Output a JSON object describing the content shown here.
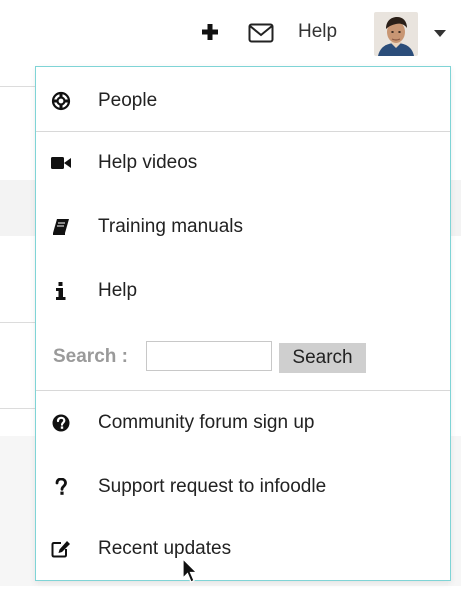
{
  "topbar": {
    "add_icon": "plus-icon",
    "mail_icon": "envelope-icon",
    "help_label": "Help",
    "avatar_icon": "user-avatar",
    "caret_icon": "caret-down-icon"
  },
  "dropdown": {
    "border_color": "#7fd4d6",
    "items": [
      {
        "label": "People",
        "icon": "life-ring-icon"
      },
      {
        "label": "Help videos",
        "icon": "video-camera-icon"
      },
      {
        "label": "Training manuals",
        "icon": "book-icon"
      },
      {
        "label": "Help",
        "icon": "info-icon"
      }
    ],
    "search": {
      "label": "Search :",
      "input_value": "",
      "button_label": "Search"
    },
    "items2": [
      {
        "label": "Community forum sign up",
        "icon": "question-circle-icon"
      },
      {
        "label": "Support request to infoodle",
        "icon": "question-icon"
      },
      {
        "label": "Recent updates",
        "icon": "edit-icon"
      }
    ]
  }
}
